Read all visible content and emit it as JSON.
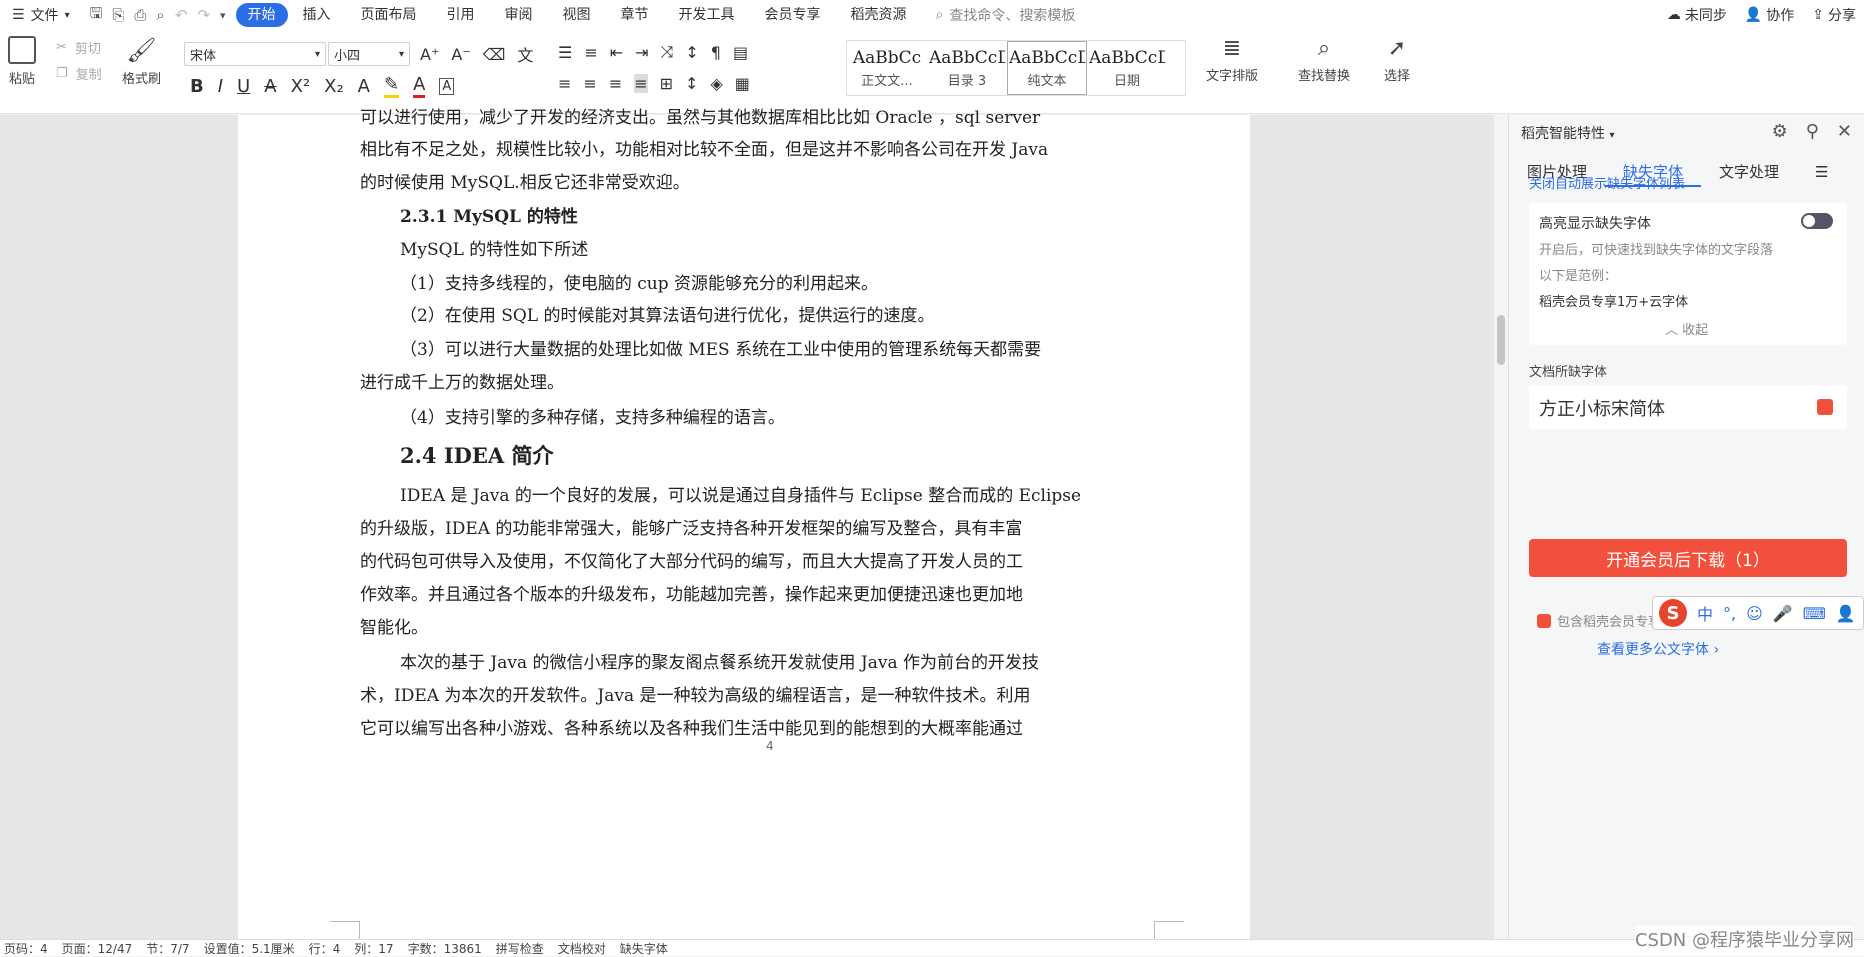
{
  "menubar": {
    "file_label": "文件",
    "tabs": [
      "开始",
      "插入",
      "页面布局",
      "引用",
      "审阅",
      "视图",
      "章节",
      "开发工具",
      "会员专享",
      "稻壳资源"
    ],
    "search_placeholder": "查找命令、搜索模板",
    "right": {
      "sync": "未同步",
      "collab": "协作",
      "share": "分享"
    }
  },
  "ribbon": {
    "paste": "粘贴",
    "cut": "剪切",
    "copy": "复制",
    "format_painter": "格式刷",
    "font_name": "宋体",
    "font_size": "小四",
    "styles": [
      {
        "preview": "AaBbCc",
        "name": "正文文..."
      },
      {
        "preview": "AaBbCcD",
        "name": "目录 3"
      },
      {
        "preview": "AaBbCcD",
        "name": "纯文本"
      },
      {
        "preview": "AaBbCcD",
        "name": "日期"
      }
    ],
    "text_layout": "文字排版",
    "find_replace": "查找替换",
    "select": "选择"
  },
  "document": {
    "lines": [
      {
        "text": "可以进行使用，减少了开发的经济支出。虽然与其他数据库相比比如 Oracle ，sql server",
        "cls": ""
      },
      {
        "text": "相比有不足之处，规模性比较小，功能相对比较不全面，但是这并不影响各公司在开发 Java",
        "cls": ""
      },
      {
        "text": "的时候使用 MySQL.相反它还非常受欢迎。",
        "cls": ""
      },
      {
        "text": "2.3.1    MySQL 的特性",
        "cls": "h3"
      },
      {
        "text": "MySQL 的特性如下所述",
        "cls": ""
      },
      {
        "text": "（1）支持多线程的，使电脑的 cup 资源能够充分的利用起来。",
        "cls": ""
      },
      {
        "text": "（2）在使用 SQL 的时候能对其算法语句进行优化，提供运行的速度。",
        "cls": ""
      },
      {
        "text": "（3）可以进行大量数据的处理比如做 MES 系统在工业中使用的管理系统每天都需要",
        "cls": ""
      },
      {
        "text": "进行成千上万的数据处理。",
        "cls": ""
      },
      {
        "text": "（4）支持引擎的多种存储，支持多种编程的语言。",
        "cls": ""
      },
      {
        "text": "2.4    IDEA 简介",
        "cls": "h2"
      },
      {
        "text": "IDEA 是 Java 的一个良好的发展，可以说是通过自身插件与 Eclipse 整合而成的 Eclipse",
        "cls": ""
      },
      {
        "text": "的升级版，IDEA 的功能非常强大，能够广泛支持各种开发框架的编写及整合，具有丰富",
        "cls": ""
      },
      {
        "text": "的代码包可供导入及使用，不仅简化了大部分代码的编写，而且大大提高了开发人员的工",
        "cls": ""
      },
      {
        "text": "作效率。并且通过各个版本的升级发布，功能越加完善，操作起来更加便捷迅速也更加地",
        "cls": ""
      },
      {
        "text": "智能化。",
        "cls": ""
      },
      {
        "text": "本次的基于 Java 的微信小程序的聚友阁点餐系统开发就使用 Java 作为前台的开发技",
        "cls": ""
      },
      {
        "text": "术，IDEA 为本次的开发软件。Java 是一种较为高级的编程语言，是一种软件技术。利用",
        "cls": ""
      },
      {
        "text": "它可以编写出各种小游戏、各种系统以及各种我们生活中能见到的能想到的大概率能通过",
        "cls": ""
      }
    ],
    "page_number": "4"
  },
  "panel": {
    "title": "稻壳智能特性",
    "tabs": [
      "图片处理",
      "缺失字体",
      "文字处理"
    ],
    "close_auto_link": "关闭自动展示缺失字体列表",
    "highlight_title": "高亮显示缺失字体",
    "highlight_desc": "开启后，可快速找到缺失字体的文字段落",
    "example_label": "以下是范例：",
    "example_text": "稻壳会员专享1万+云字体",
    "collapse": "收起",
    "missing_section": "文档所缺字体",
    "missing_font": "方正小标宋简体",
    "download_button": "开通会员后下载（1）",
    "member_note": "包含稻壳会员专享字体，需开通稻壳会员",
    "more_fonts_link": "查看更多公文字体"
  },
  "ime": {
    "mode": "中"
  },
  "statusbar": {
    "items": [
      "页码：4",
      "页面：12/47",
      "节：7/7",
      "设置值：5.1厘米",
      "行：4",
      "列：17",
      "字数：13861",
      "拼写检查",
      "文档校对",
      "缺失字体"
    ]
  },
  "watermark": "CSDN @程序猿毕业分享网"
}
